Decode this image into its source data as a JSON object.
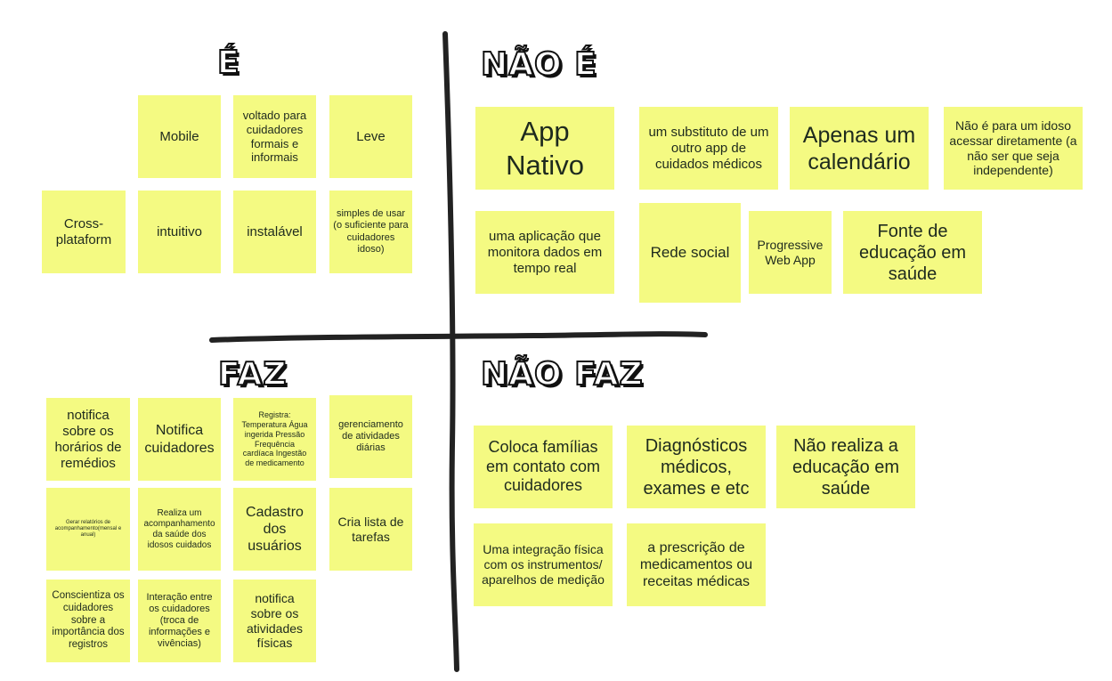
{
  "headings": {
    "e": "É",
    "nao_e": "NÃO É",
    "faz": "FAZ",
    "nao_faz": "NÃO FAZ"
  },
  "note_color": "#f4fa82",
  "e_notes": [
    "Mobile",
    "voltado para cuidadores formais e informais",
    "Leve",
    "Cross-plataform",
    "intuitivo",
    "instalável",
    "simples de usar (o suficiente para cuidadores idoso)"
  ],
  "nao_e_notes": [
    "App Nativo",
    "um substituto de um outro app de cuidados médicos",
    "Apenas um calendário",
    "Não é para um idoso acessar diretamente (a não ser que seja independente)",
    "uma aplicação que monitora dados em tempo real",
    "Rede social",
    "Progressive Web App",
    "Fonte de educação em saúde"
  ],
  "faz_notes": [
    "notifica sobre os horários de remédios",
    "Notifica cuidadores",
    "Registra: Temperatura Água ingerida Pressão Frequência cardíaca Ingestão de medicamento",
    "gerenciamento de atividades diárias",
    "Gerar relatórios de acompanhamento(mensal e anual)",
    "Realiza um acompanhamento da saúde dos idosos cuidados",
    "Cadastro dos usuários",
    "Cria lista de tarefas",
    "Conscientiza os cuidadores sobre a importância dos registros",
    "Interação entre os cuidadores (troca de informações e vivências)",
    "notifica sobre os atividades físicas"
  ],
  "nao_faz_notes": [
    "Coloca famílias em contato com cuidadores",
    "Diagnósticos médicos, exames e etc",
    "Não realiza a educação em saúde",
    "Uma integração física com os instrumentos/ aparelhos de medição",
    "a prescrição de medicamentos ou receitas médicas"
  ]
}
